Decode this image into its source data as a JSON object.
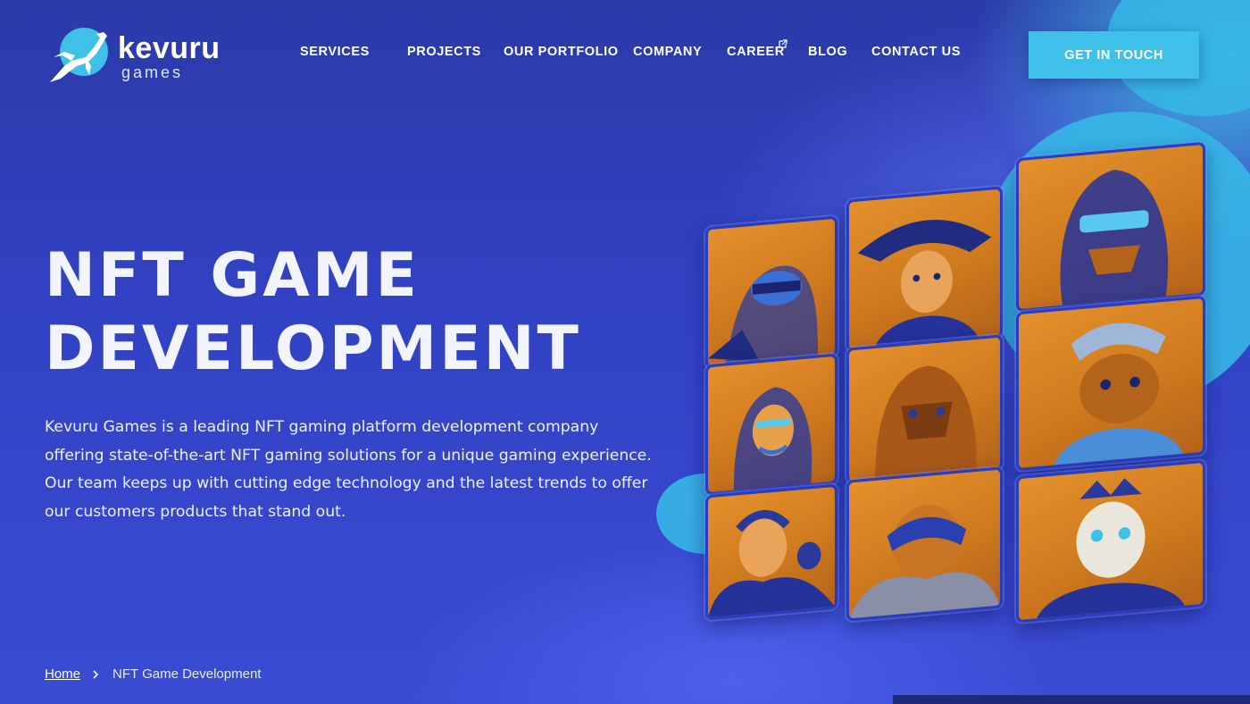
{
  "brand": {
    "name": "kevuru",
    "sub": "games",
    "logo_icon": "leaping-deer-logo-icon",
    "accent_color": "#3ec0e8",
    "background_color": "#3242c4",
    "card_color": "#d9852a"
  },
  "nav": {
    "items": [
      {
        "label": "SERVICES"
      },
      {
        "label": "PROJECTS"
      },
      {
        "label": "OUR PORTFOLIO"
      },
      {
        "label": "COMPANY"
      },
      {
        "label": "CAREER",
        "icon": "external-link-icon"
      },
      {
        "label": "BLOG"
      },
      {
        "label": "CONTACT US"
      }
    ],
    "cta_label": "GET IN TOUCH"
  },
  "hero": {
    "title_line1": "NFT GAME",
    "title_line2": "DEVELOPMENT",
    "description": "Kevuru Games is a leading NFT gaming platform development company offering state-of-the-art NFT gaming solutions for a unique gaming experience. Our team keeps up with cutting edge technology and the latest trends to offer our customers products that stand out."
  },
  "breadcrumb": {
    "home": "Home",
    "separator_icon": "chevron-right-icon",
    "current": "NFT Game Development"
  },
  "gallery": {
    "cards": [
      {
        "icon": "masked-warrior-portrait"
      },
      {
        "icon": "witch-hat-portrait"
      },
      {
        "icon": "armored-knight-portrait"
      },
      {
        "icon": "tribal-woman-portrait"
      },
      {
        "icon": "stone-golem-portrait"
      },
      {
        "icon": "lizard-creature-portrait"
      },
      {
        "icon": "soldier-with-cat-portrait"
      },
      {
        "icon": "masked-brute-portrait"
      },
      {
        "icon": "skeleton-king-portrait"
      }
    ]
  }
}
